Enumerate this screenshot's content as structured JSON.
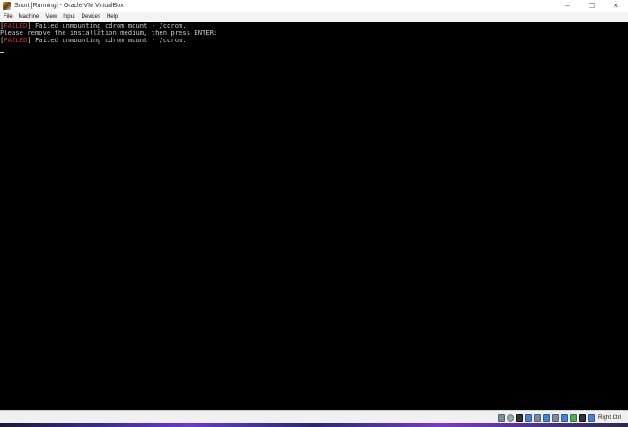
{
  "window": {
    "title": "Snort  [Running] - Oracle VM VirtualBox",
    "controls": {
      "minimize": "–",
      "maximize": "☐",
      "close": "✕"
    }
  },
  "menubar": {
    "items": [
      {
        "label": "File"
      },
      {
        "label": "Machine"
      },
      {
        "label": "View"
      },
      {
        "label": "Input"
      },
      {
        "label": "Devices"
      },
      {
        "label": "Help"
      }
    ]
  },
  "console": {
    "lines": [
      {
        "prefix_open": "[",
        "status": "FAILED",
        "prefix_close": "]",
        "text": " Failed unmounting cdrom.mount - /cdrom."
      },
      {
        "text": "Please remove the installation medium, then press ENTER:"
      },
      {
        "prefix_open": "[",
        "status": "FAILED",
        "prefix_close": "]",
        "text": " Failed unmounting cdrom.mount - /cdrom."
      }
    ]
  },
  "statusbar": {
    "icons": [
      "hard-disk-icon",
      "optical-drive-icon",
      "audio-icon",
      "network-icon",
      "usb-icon",
      "shared-folders-icon",
      "display-icon",
      "video-capture-icon",
      "virtualization-icon",
      "mouse-integration-icon"
    ],
    "host_key": "Right Ctrl"
  },
  "colors": {
    "failed_red": "#d03030",
    "console_text": "#c8c8c8",
    "console_bg": "#000000"
  }
}
